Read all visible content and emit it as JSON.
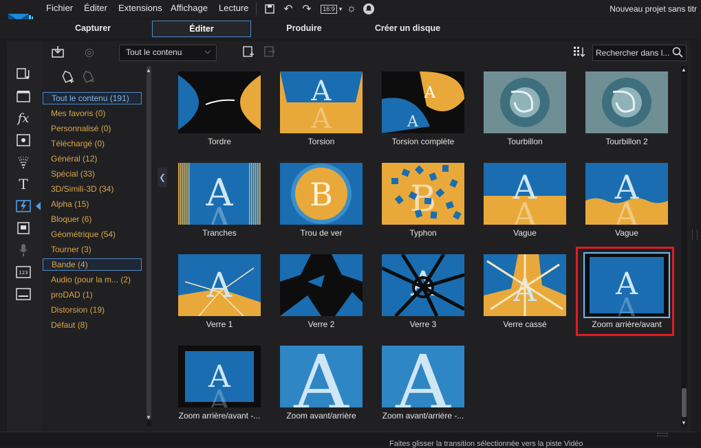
{
  "app": {
    "title": "Nouveau projet sans titr"
  },
  "menu": [
    "Fichier",
    "Éditer",
    "Extensions",
    "Affichage",
    "Lecture"
  ],
  "toolbar": {
    "aspect": "16:9"
  },
  "modes": [
    "Capturer",
    "Éditer",
    "Produire",
    "Créer un disque"
  ],
  "library": {
    "filter": "Tout le contenu",
    "search_placeholder": "Rechercher dans l..."
  },
  "categories": [
    {
      "label": "Tout le contenu (191)"
    },
    {
      "label": "Mes favoris  (0)"
    },
    {
      "label": "Personnalisé  (0)"
    },
    {
      "label": "Téléchargé  (0)"
    },
    {
      "label": "Général  (12)"
    },
    {
      "label": "Spécial  (33)"
    },
    {
      "label": "3D/Simili-3D  (34)"
    },
    {
      "label": "Alpha  (15)"
    },
    {
      "label": "Bloquer  (6)"
    },
    {
      "label": "Géométrique  (54)"
    },
    {
      "label": "Tourner  (3)"
    },
    {
      "label": "Bande  (4)"
    },
    {
      "label": "Audio (pour la m...  (2)"
    },
    {
      "label": "proDAD  (1)"
    },
    {
      "label": "Distorsion  (19)"
    },
    {
      "label": "Défaut  (8)"
    }
  ],
  "transitions": [
    {
      "label": "Tordre",
      "style": "twist"
    },
    {
      "label": "Torsion",
      "style": "torsion"
    },
    {
      "label": "Torsion complète",
      "style": "torsion-full"
    },
    {
      "label": "Tourbillon",
      "style": "swirl"
    },
    {
      "label": "Tourbillon 2",
      "style": "swirl"
    },
    {
      "label": "Tranches",
      "style": "slices"
    },
    {
      "label": "Trou de ver",
      "style": "wormhole"
    },
    {
      "label": "Typhon",
      "style": "typhoon"
    },
    {
      "label": "Vague",
      "style": "wave"
    },
    {
      "label": "Vague",
      "style": "wave2"
    },
    {
      "label": "Verre 1",
      "style": "glass1"
    },
    {
      "label": "Verre 2",
      "style": "glass2"
    },
    {
      "label": "Verre 3",
      "style": "glass3"
    },
    {
      "label": "Verre cassé",
      "style": "broken"
    },
    {
      "label": "Zoom arrière/avant",
      "style": "zoom-in"
    },
    {
      "label": "Zoom arrière/avant -...",
      "style": "zoom-out"
    },
    {
      "label": "Zoom avant/arrière",
      "style": "zoom-big"
    },
    {
      "label": "Zoom avant/arrière -...",
      "style": "zoom-big"
    }
  ],
  "status": "Faites glisser la transition sélectionnée vers la piste Vidéo",
  "colors": {
    "accent_blue": "#4f88c8",
    "highlight_red": "#e21b23",
    "category_text": "#d9a74a"
  }
}
